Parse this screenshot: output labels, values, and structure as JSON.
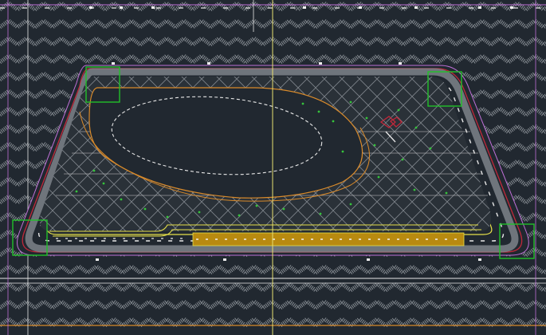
{
  "window": {
    "view": "cad-model-space",
    "background_color": "#212830"
  },
  "colors": {
    "hatch_gray": "#9aa0a6",
    "boundary_red": "#c0283a",
    "boundary_magenta": "#c070d8",
    "curb_yellow": "#e6e04a",
    "path_orange": "#d98a2a",
    "pond_dashed_white": "#e8e8e8",
    "grid_white": "#c8c8c8",
    "crosshatch": "#8a8f96",
    "highlight_green": "#22c02a",
    "bench_fill_gold": "#b88a10",
    "crosshair_yellow": "#e8e070",
    "planting_green": "#36c43c"
  },
  "selection_boxes": [
    "top-left-corner",
    "top-right-corner",
    "bottom-left-corner",
    "bottom-right-corner"
  ],
  "icons": {
    "crosshair": "crosshair-cursor-icon",
    "marker": "red-selection-marker-icon"
  }
}
